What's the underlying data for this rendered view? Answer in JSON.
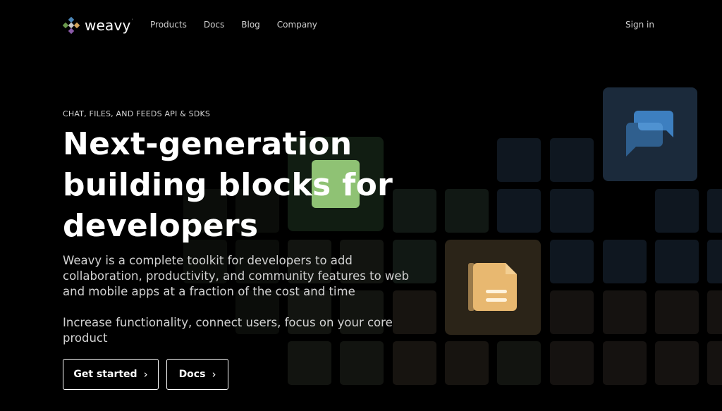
{
  "brand": {
    "name": "weavy",
    "mark": "'"
  },
  "nav": {
    "items": [
      {
        "label": "Products"
      },
      {
        "label": "Docs"
      },
      {
        "label": "Blog"
      },
      {
        "label": "Company"
      }
    ],
    "sign_in": "Sign in"
  },
  "hero": {
    "eyebrow": "CHAT, FILES, AND FEEDS API & SDKS",
    "title": "Next-generation building blocks for developers",
    "description": "Weavy is a complete toolkit for developers to add collaboration, productivity, and community features to web and mobile apps at a fraction of the cost and time",
    "description2": "Increase functionality, connect users, focus on your core product",
    "cta_primary": "Get started",
    "cta_secondary": "Docs",
    "chevron": "›"
  },
  "icons": {
    "chat": "chat-bubbles-icon",
    "file": "document-icon",
    "feed": "feed-icon"
  },
  "colors": {
    "background": "#000000",
    "tile_blue": "#1b2a3b",
    "tile_green": "#8fc274",
    "tile_orange": "#e8b870",
    "chat_blue": "#3d7fc0"
  }
}
